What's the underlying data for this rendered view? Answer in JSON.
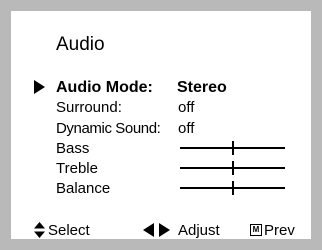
{
  "menu": {
    "title": "Audio",
    "items": [
      {
        "label": "Audio Mode:",
        "value": "Stereo",
        "selected": true
      },
      {
        "label": "Surround:",
        "value": "off"
      },
      {
        "label": "Dynamic Sound:",
        "value": "off"
      },
      {
        "label": "Bass",
        "level": 0.5
      },
      {
        "label": "Treble",
        "level": 0.5
      },
      {
        "label": "Balance",
        "level": 0.5
      }
    ]
  },
  "footer": {
    "select_label": "Select",
    "adjust_label": "Adjust",
    "prev_label": "Prev",
    "prev_icon_glyph": "M"
  }
}
